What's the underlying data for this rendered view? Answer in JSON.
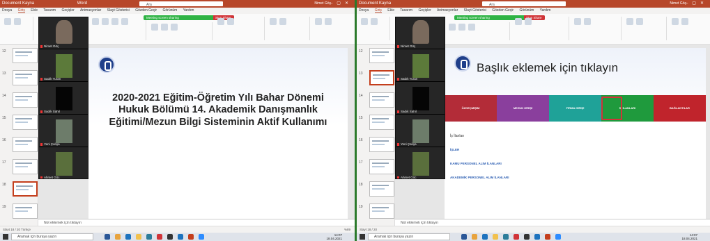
{
  "left": {
    "window_title": "Document Kayna",
    "app": "Word",
    "search": "Ara",
    "user": "Nimet Göç",
    "tabs": [
      "Dosya",
      "Giriş",
      "Ekle",
      "Tasarım",
      "Geçişler",
      "Animasyonlar",
      "Slayt Gösterisi",
      "Gözden Geçir",
      "Görünüm",
      "Yardım"
    ],
    "share_text": "Meeting screen sharing",
    "stop_share": "Stop Share",
    "thumb_numbers": [
      "12",
      "13",
      "14",
      "15",
      "16",
      "17",
      "18",
      "19"
    ],
    "participants": [
      "Nimet Göç",
      "Sadık Turan",
      "Sadık Sahil",
      "Yeni Çalışa",
      "Ahmet Göç"
    ],
    "slide_title": "2020-2021 Eğitim-Öğretim Yılı Bahar Dönemi Hukuk Bölümü 14. Akademik Danışmanlık Eğitimi/Mezun Bilgi Sisteminin Aktif Kullanımı",
    "notes": "Not eklemek için tıklayın",
    "status": "Slayt 18 / 20   Türkçe",
    "zoom": "%89",
    "taskbar_search": "Aramak için buraya yazın",
    "time": "14:07",
    "date": "18.04.2021"
  },
  "right": {
    "window_title": "Document Kayna",
    "search": "Ara",
    "user": "Nimet Göç",
    "tabs": [
      "Dosya",
      "Giriş",
      "Ekle",
      "Tasarım",
      "Geçişler",
      "Animasyonlar",
      "Slayt Gösterisi",
      "Gözden Geçir",
      "Görünüm",
      "Yardım"
    ],
    "share_text": "Meeting screen sharing",
    "stop_share": "Stop Share",
    "thumb_numbers": [
      "12",
      "13",
      "14",
      "15",
      "16",
      "17",
      "18",
      "19"
    ],
    "participants": [
      "Nimet Göç",
      "Sadık Turan",
      "Sadık Sahil",
      "Yeni Çalışa",
      "Ahmet Göç"
    ],
    "slide_title": "Başlık eklemek için tıklayın",
    "nav": [
      "ÖZGEÇMİŞİM",
      "MEZUN GİRİŞİ",
      "FİRMA GİRİŞİ",
      "İŞ İLANLARI",
      "BAĞLANTILAR"
    ],
    "nav_colors": [
      "#b32c38",
      "#8a3f9d",
      "#1fa298",
      "#1f9a3d",
      "#c0242c"
    ],
    "ilanlar_heading": "İş İlanları",
    "ilanlar": [
      "İŞLER",
      "KAMU PERSONEL ALIM İLANLARI",
      "AKADEMİK PERSONEL ALIM İLANLARI"
    ],
    "notes": "Not eklemek için tıklayın",
    "status": "Slayt 18 / 20",
    "taskbar_search": "Aramak için buraya yazın",
    "time": "14:07",
    "date": "18.04.2021"
  }
}
